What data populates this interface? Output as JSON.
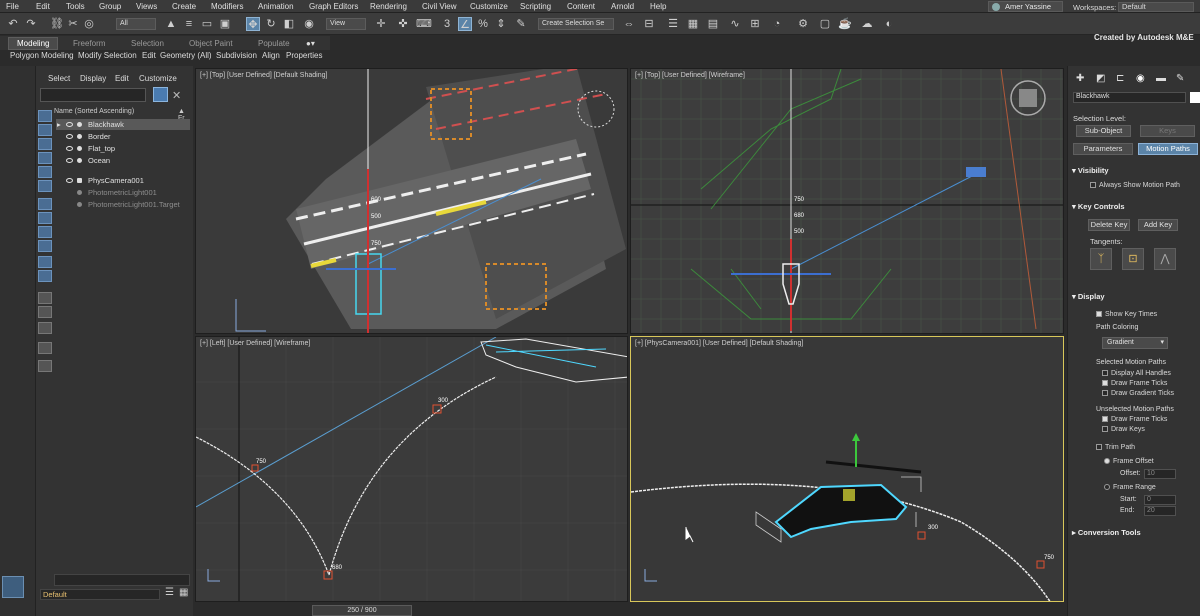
{
  "menubar": {
    "items": [
      "File",
      "Edit",
      "Tools",
      "Group",
      "Views",
      "Create",
      "Modifiers",
      "Animation",
      "Graph Editors",
      "Rendering",
      "Civil View",
      "Customize",
      "Scripting",
      "Content",
      "Arnold",
      "Help"
    ],
    "user": "Amer Yassine",
    "workspace_label": "Workspaces:",
    "workspace_value": "Default"
  },
  "toolbar": {
    "filter_all": "All",
    "view_dropdown": "View",
    "selection_set": "Create Selection Se",
    "brand": "Created by Autodesk M&E"
  },
  "ribbon": {
    "tabs": [
      "Modeling",
      "Freeform",
      "Selection",
      "Object Paint",
      "Populate"
    ],
    "active_tab": "Modeling",
    "row2": [
      "Polygon Modeling",
      "Modify Selection",
      "Edit",
      "Geometry (All)",
      "Subdivision",
      "Align",
      "Properties"
    ]
  },
  "scene_explorer": {
    "menus": [
      "Select",
      "Display",
      "Edit",
      "Customize"
    ],
    "header": "Name (Sorted Ascending)",
    "header_right": "▲ Fr",
    "items": [
      {
        "name": "Blackhawk",
        "selected": true,
        "dim": false
      },
      {
        "name": "Border",
        "selected": false,
        "dim": false
      },
      {
        "name": "Flat_top",
        "selected": false,
        "dim": false
      },
      {
        "name": "Ocean",
        "selected": false,
        "dim": false
      },
      {
        "name": "PhysCamera001",
        "selected": false,
        "dim": false
      },
      {
        "name": "PhotometricLight001",
        "selected": false,
        "dim": true
      },
      {
        "name": "PhotometricLight001.Target",
        "selected": false,
        "dim": true
      }
    ],
    "layer": "Default"
  },
  "viewports": {
    "top_left": "[+] [Top] [User Defined] [Default Shading]",
    "top_right": "[+] [Top] [User Defined] [Wireframe]",
    "bottom_left": "[+] [Left] [User Defined] [Wireframe]",
    "bottom_right": "[+] [PhysCamera001] [User Defined] [Default Shading]",
    "path_labels": {
      "tl_a": "500",
      "tl_b": "600",
      "tl_c": "750",
      "tr_a": "750",
      "tr_b": "680",
      "tr_c": "500",
      "bl_a": "750",
      "bl_b": "300",
      "bl_c": "680",
      "br_a": "300",
      "br_b": "750"
    }
  },
  "status": {
    "frame_counter": "250 / 900"
  },
  "command_panel": {
    "object_name": "Blackhawk",
    "selection_level": "Selection Level:",
    "sub_object": "Sub-Object",
    "keys": "Keys",
    "parameters": "Parameters",
    "motion_paths": "Motion Paths",
    "visibility": {
      "title": "Visibility",
      "always_show": "Always Show Motion Path"
    },
    "key_controls": {
      "title": "Key Controls",
      "delete_key": "Delete Key",
      "add_key": "Add Key",
      "tangents": "Tangents:"
    },
    "display": {
      "title": "Display",
      "show_key_times": "Show Key Times",
      "path_coloring": "Path Coloring",
      "gradient": "Gradient",
      "selected_paths": "Selected Motion Paths",
      "display_all_handles": "Display All Handles",
      "draw_frame_ticks": "Draw Frame Ticks",
      "draw_gradient_ticks": "Draw Gradient Ticks",
      "unselected_paths": "Unselected Motion Paths",
      "draw_frame_ticks2": "Draw Frame Ticks",
      "draw_keys": "Draw Keys",
      "trim_path": "Trim Path",
      "frame_offset": "Frame Offset",
      "offset_label": "Offset:",
      "offset_val": "10",
      "frame_range": "Frame Range",
      "start_label": "Start:",
      "start_val": "0",
      "end_label": "End:",
      "end_val": "20"
    },
    "conversion_tools": "Conversion Tools"
  }
}
